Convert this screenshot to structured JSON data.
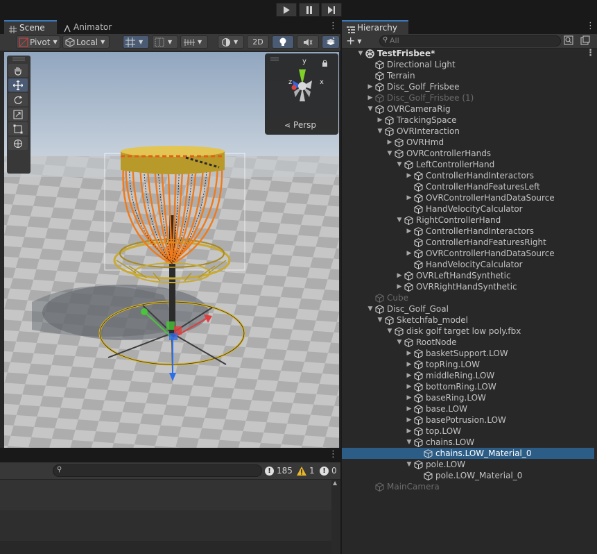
{
  "toolbar": {
    "play_icon": "play-icon",
    "pause_icon": "pause-icon",
    "step_icon": "step-icon"
  },
  "scene": {
    "tabs": [
      {
        "label": "Scene",
        "icon": "grid-icon"
      },
      {
        "label": "Animator",
        "icon": "animator-icon"
      }
    ],
    "pivot_label": "Pivot",
    "local_label": "Local",
    "mode_2d": "2D",
    "gizmo": {
      "axis_y": "y",
      "axis_z": "z",
      "axis_x": "x",
      "projection": "Persp"
    },
    "tools": [
      "hand-icon",
      "move-icon",
      "rotate-icon",
      "scale-icon",
      "rect-icon",
      "transform-icon"
    ]
  },
  "console": {
    "search_placeholder": "",
    "errors": "185",
    "warnings": "1",
    "infos": "0"
  },
  "hierarchy": {
    "tab_label": "Hierarchy",
    "search_placeholder": "All",
    "rows": [
      {
        "label": "TestFrisbee*",
        "indent": 0,
        "arrow": "down",
        "kind": "scene",
        "bold": true
      },
      {
        "label": "Directional Light",
        "indent": 1,
        "arrow": "",
        "kind": "object"
      },
      {
        "label": "Terrain",
        "indent": 1,
        "arrow": "",
        "kind": "object"
      },
      {
        "label": "Disc_Golf_Frisbee",
        "indent": 1,
        "arrow": "right",
        "kind": "object"
      },
      {
        "label": "Disc_Golf_Frisbee (1)",
        "indent": 1,
        "arrow": "right",
        "kind": "object",
        "dim": true
      },
      {
        "label": "OVRCameraRig",
        "indent": 1,
        "arrow": "down",
        "kind": "object"
      },
      {
        "label": "TrackingSpace",
        "indent": 2,
        "arrow": "right",
        "kind": "object"
      },
      {
        "label": "OVRInteraction",
        "indent": 2,
        "arrow": "down",
        "kind": "object"
      },
      {
        "label": "OVRHmd",
        "indent": 3,
        "arrow": "right",
        "kind": "object"
      },
      {
        "label": "OVRControllerHands",
        "indent": 3,
        "arrow": "down",
        "kind": "object"
      },
      {
        "label": "LeftControllerHand",
        "indent": 4,
        "arrow": "down",
        "kind": "object"
      },
      {
        "label": "ControllerHandInteractors",
        "indent": 5,
        "arrow": "right",
        "kind": "object"
      },
      {
        "label": "ControllerHandFeaturesLeft",
        "indent": 5,
        "arrow": "",
        "kind": "object"
      },
      {
        "label": "OVRControllerHandDataSource",
        "indent": 5,
        "arrow": "right",
        "kind": "object"
      },
      {
        "label": "HandVelocityCalculator",
        "indent": 5,
        "arrow": "",
        "kind": "object"
      },
      {
        "label": "RightControllerHand",
        "indent": 4,
        "arrow": "down",
        "kind": "object"
      },
      {
        "label": "ControllerHandInteractors",
        "indent": 5,
        "arrow": "right",
        "kind": "object"
      },
      {
        "label": "ControllerHandFeaturesRight",
        "indent": 5,
        "arrow": "",
        "kind": "object"
      },
      {
        "label": "OVRControllerHandDataSource",
        "indent": 5,
        "arrow": "right",
        "kind": "object"
      },
      {
        "label": "HandVelocityCalculator",
        "indent": 5,
        "arrow": "",
        "kind": "object"
      },
      {
        "label": "OVRLeftHandSynthetic",
        "indent": 4,
        "arrow": "right",
        "kind": "object"
      },
      {
        "label": "OVRRightHandSynthetic",
        "indent": 4,
        "arrow": "right",
        "kind": "object"
      },
      {
        "label": "Cube",
        "indent": 1,
        "arrow": "",
        "kind": "object",
        "dim": true
      },
      {
        "label": "Disc_Golf_Goal",
        "indent": 1,
        "arrow": "down",
        "kind": "object"
      },
      {
        "label": "Sketchfab_model",
        "indent": 2,
        "arrow": "down",
        "kind": "object"
      },
      {
        "label": "disk golf target low poly.fbx",
        "indent": 3,
        "arrow": "down",
        "kind": "object"
      },
      {
        "label": "RootNode",
        "indent": 4,
        "arrow": "down",
        "kind": "object"
      },
      {
        "label": "basketSupport.LOW",
        "indent": 5,
        "arrow": "right",
        "kind": "object"
      },
      {
        "label": "topRing.LOW",
        "indent": 5,
        "arrow": "right",
        "kind": "object"
      },
      {
        "label": "middleRing.LOW",
        "indent": 5,
        "arrow": "right",
        "kind": "object"
      },
      {
        "label": "bottomRing.LOW",
        "indent": 5,
        "arrow": "right",
        "kind": "object"
      },
      {
        "label": "baseRing.LOW",
        "indent": 5,
        "arrow": "right",
        "kind": "object"
      },
      {
        "label": "base.LOW",
        "indent": 5,
        "arrow": "right",
        "kind": "object"
      },
      {
        "label": "basePotrusion.LOW",
        "indent": 5,
        "arrow": "right",
        "kind": "object"
      },
      {
        "label": "top.LOW",
        "indent": 5,
        "arrow": "right",
        "kind": "object"
      },
      {
        "label": "chains.LOW",
        "indent": 5,
        "arrow": "down",
        "kind": "object"
      },
      {
        "label": "chains.LOW_Material_0",
        "indent": 6,
        "arrow": "",
        "kind": "object",
        "selected": true
      },
      {
        "label": "pole.LOW",
        "indent": 5,
        "arrow": "down",
        "kind": "object"
      },
      {
        "label": "pole.LOW_Material_0",
        "indent": 6,
        "arrow": "",
        "kind": "object"
      },
      {
        "label": "MainCamera",
        "indent": 1,
        "arrow": "",
        "kind": "object",
        "dim": true
      }
    ]
  },
  "colors": {
    "selection": "#2c5d87",
    "accent": "#3a79bb",
    "chains": "#f07a1a",
    "basket": "#d8b83a"
  }
}
